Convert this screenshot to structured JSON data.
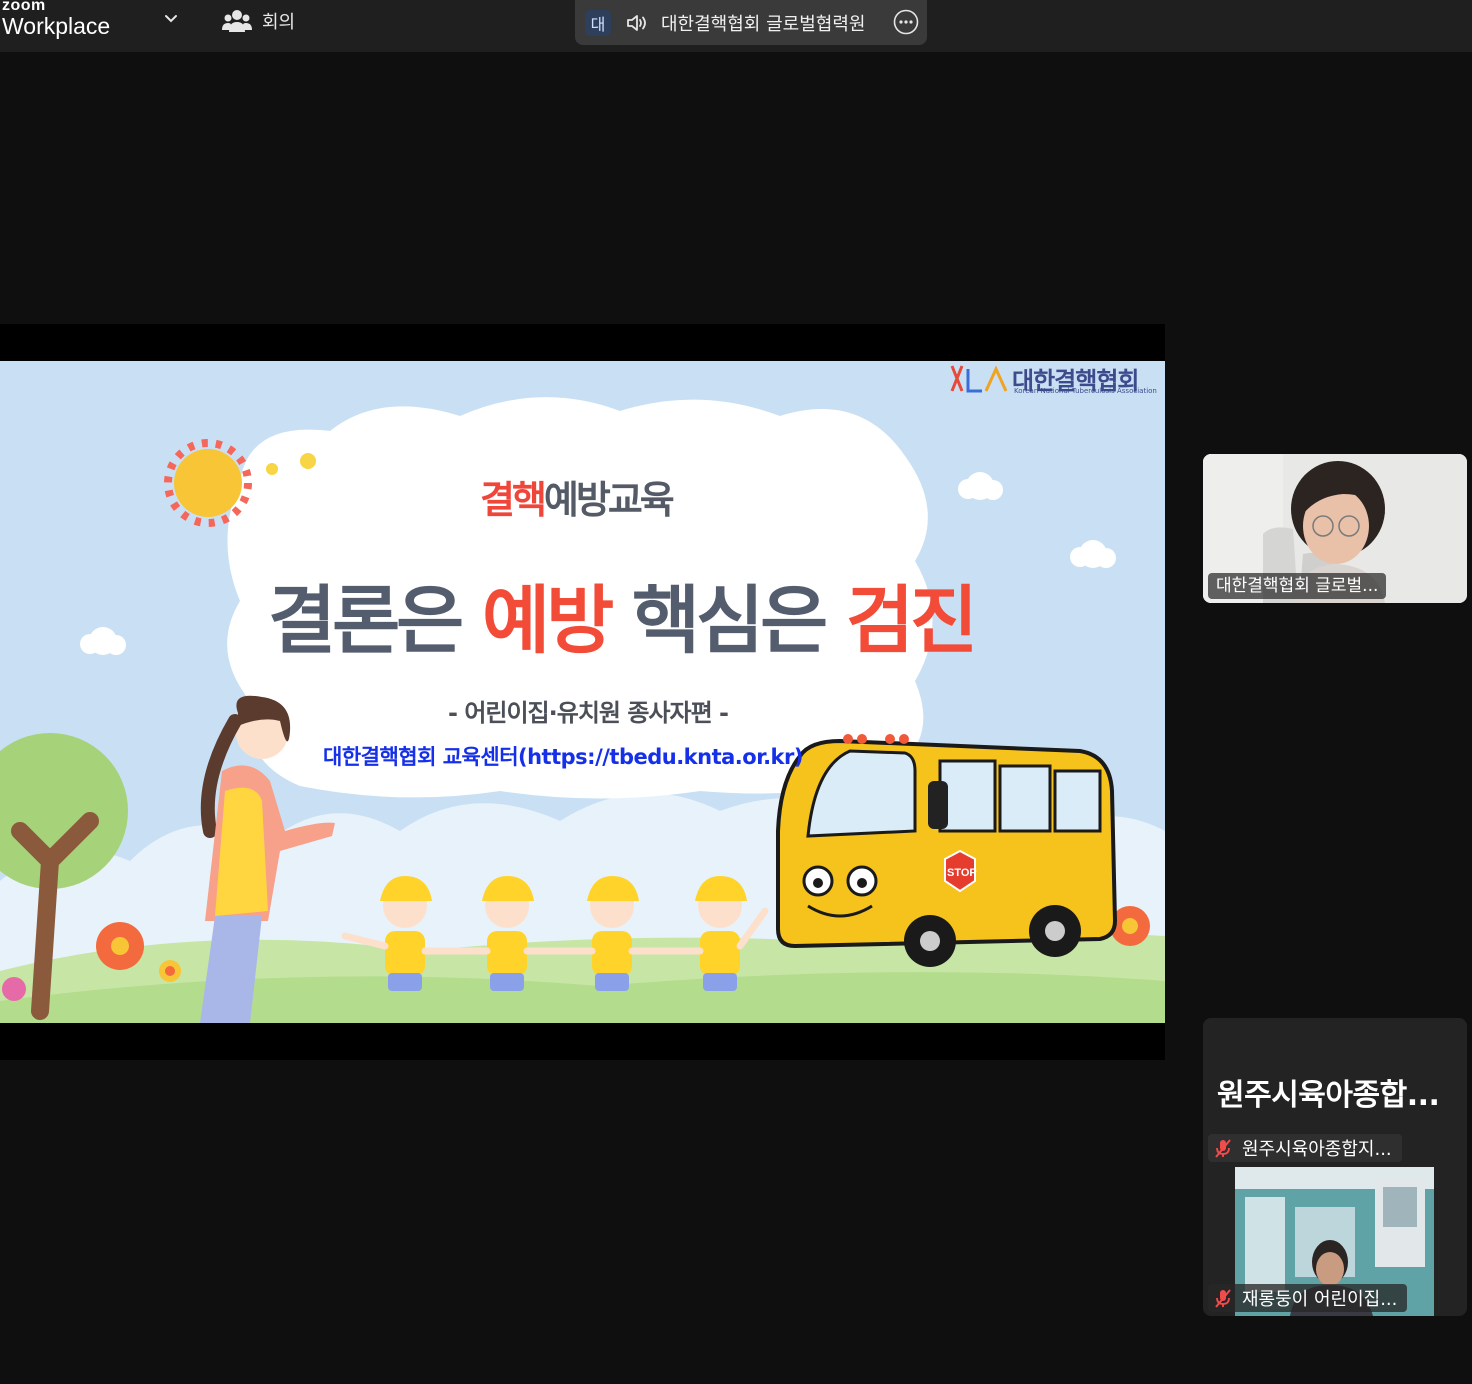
{
  "app": {
    "brand_top": "zoom",
    "brand_bottom": "Workplace",
    "meeting_label": "회의"
  },
  "speaker_pill": {
    "avatar_initial": "대",
    "name": "대한결핵협회 글로벌협력원"
  },
  "slide": {
    "logo_korean": "대한결핵협회",
    "logo_english": "Korean National Tuberculosis Association",
    "kicker_red": "결핵",
    "kicker_gray": "예방교육",
    "title_part1": "결론은 ",
    "title_part2": "예방",
    "title_part3": " 핵심은 ",
    "title_part4": "검진",
    "subtitle": "- 어린이집·유치원 종사자편 -",
    "link": "대한결핵협회 교육센터(https://tbedu.knta.or.kr)",
    "bus_sign": "STOP"
  },
  "participants": [
    {
      "name": "대한결핵협회 글로벌..."
    },
    {
      "card_name": "원주시육아종합...",
      "name": "원주시육아종합지...",
      "sub_name": "재롱둥이 어린이집..."
    }
  ],
  "colors": {
    "topbar": "#1f1f1f",
    "background": "#0f0f0f",
    "accent_red": "#f24b37",
    "link_blue": "#1530e8"
  }
}
